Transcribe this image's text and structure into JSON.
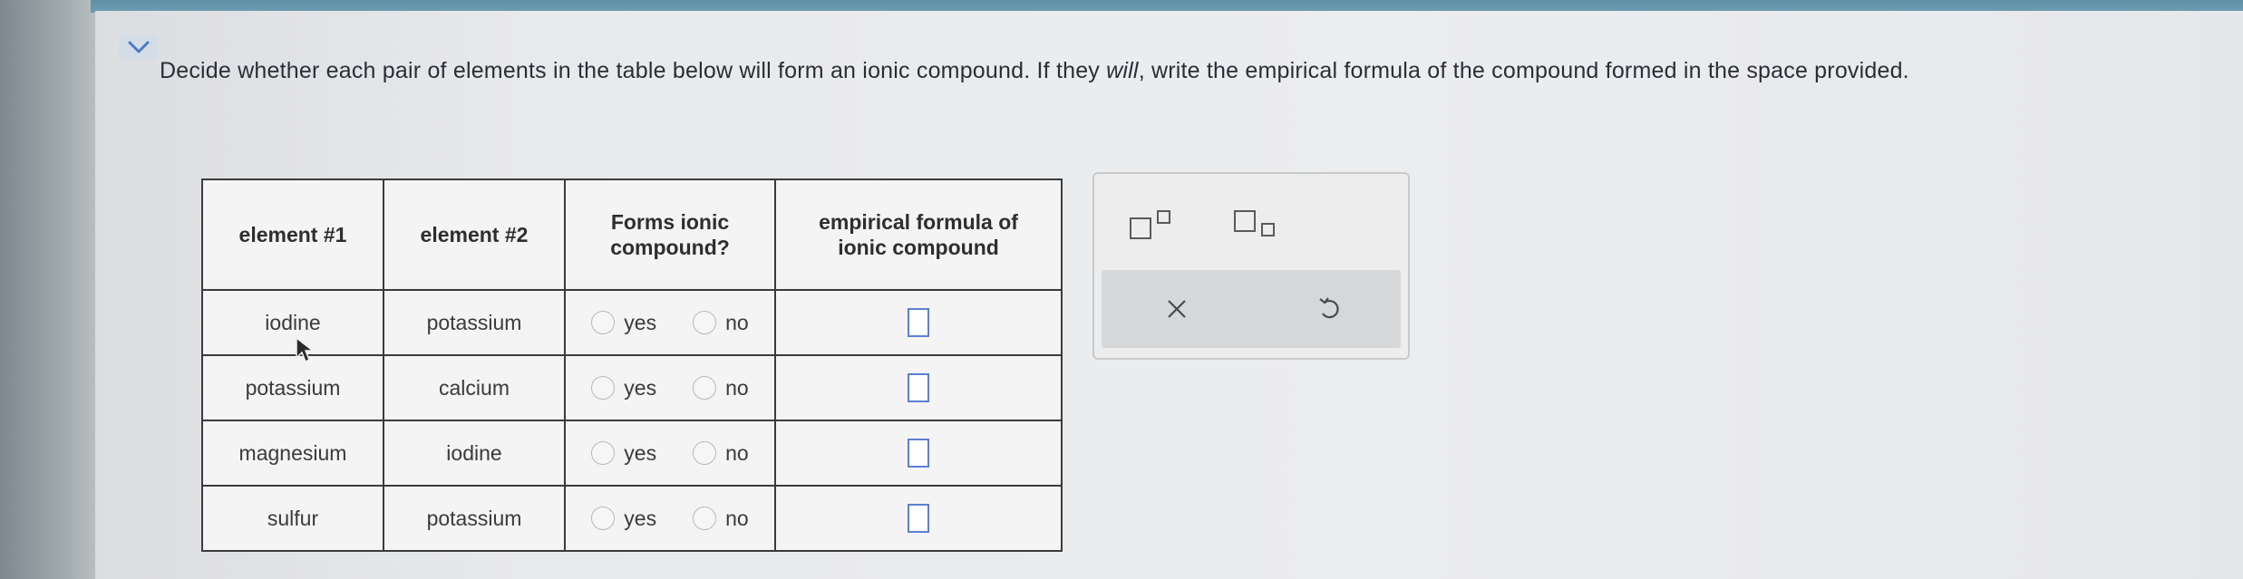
{
  "prompt": {
    "part1": "Decide whether each pair of elements in the table below will form an ionic compound. If they ",
    "emphasis": "will",
    "part2": ", write the empirical formula of the compound formed in the space provided."
  },
  "table": {
    "headers": [
      "element #1",
      "element #2",
      "Forms ionic compound?",
      "empirical formula of ionic compound"
    ],
    "rows": [
      {
        "element1": "iodine",
        "element2": "potassium",
        "yes": "yes",
        "no": "no"
      },
      {
        "element1": "potassium",
        "element2": "calcium",
        "yes": "yes",
        "no": "no"
      },
      {
        "element1": "magnesium",
        "element2": "iodine",
        "yes": "yes",
        "no": "no"
      },
      {
        "element1": "sulfur",
        "element2": "potassium",
        "yes": "yes",
        "no": "no"
      }
    ]
  },
  "tools": {
    "superscript": "superscript-icon",
    "subscript": "subscript-icon",
    "clear": "x-icon",
    "undo": "undo-icon"
  },
  "colors": {
    "answer_box_border": "#5d7fd4",
    "top_strip": "#6e9db2",
    "collapse_chevron": "#4f78c9"
  }
}
